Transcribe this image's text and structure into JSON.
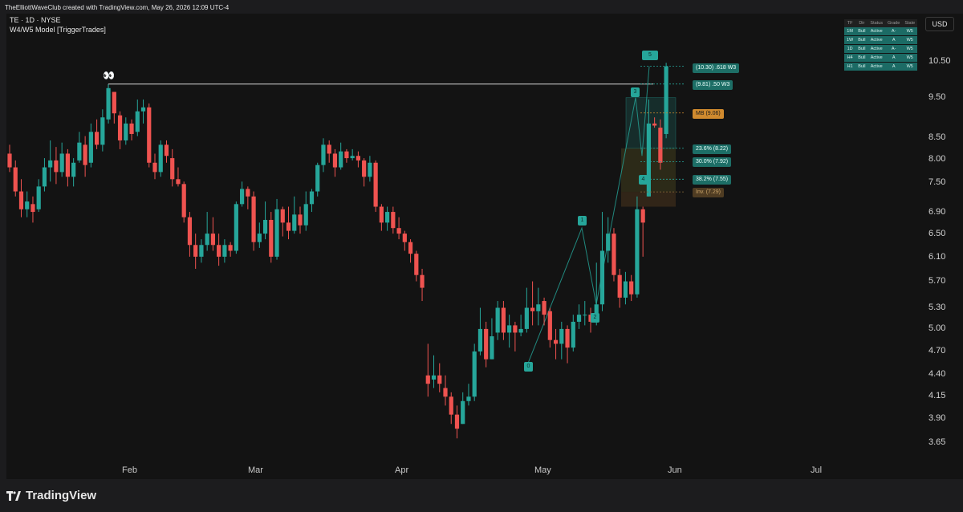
{
  "header": {
    "attribution": "TheElliottWaveClub created with TradingView.com, May 26, 2026 12:09 UTC-4"
  },
  "legend": {
    "symbol_line": "TE · 1D · NYSE",
    "indicator_line": "W4/W5 Model [TriggerTrades]"
  },
  "price_axis": {
    "currency_button": "USD",
    "labels": [
      "10.50",
      "9.50",
      "8.50",
      "8.00",
      "7.50",
      "6.90",
      "6.50",
      "6.10",
      "5.70",
      "5.30",
      "5.00",
      "4.70",
      "4.40",
      "4.15",
      "3.90",
      "3.65"
    ]
  },
  "time_axis": {
    "labels": [
      "Feb",
      "Mar",
      "Apr",
      "May",
      "Jun",
      "Jul"
    ]
  },
  "status_table": {
    "headers": [
      "TF",
      "Dir",
      "Status",
      "Grade",
      "State"
    ],
    "rows": [
      [
        "1M",
        "Bull",
        "Active",
        "A-",
        "W5"
      ],
      [
        "1W",
        "Bull",
        "Active",
        "A",
        "W5"
      ],
      [
        "1D",
        "Bull",
        "Active",
        "A-",
        "W5"
      ],
      [
        "H4",
        "Bull",
        "Active",
        "A",
        "W5"
      ],
      [
        "H1",
        "Bull",
        "Active",
        "A",
        "W5"
      ]
    ]
  },
  "levels": {
    "w3_618": "(10.30) .618 W3",
    "w3_50": "(9.81) .50 W3",
    "mb": "MB (9.06)",
    "fib_236": "23.6% (8.22)",
    "fib_30": "30.0% (7.92)",
    "fib_382": "38.2% (7.55)",
    "inv": "Inv. (7.29)"
  },
  "wave_labels": {
    "w0": "0",
    "w1": "1",
    "w2": "2",
    "w3": "3",
    "w4": "4",
    "w5": "5"
  },
  "annotation": {
    "eyes_icon": "👀"
  },
  "footer": {
    "brand": "TradingView"
  },
  "colors": {
    "up": "#26a69a",
    "down": "#ef5350",
    "background": "#131313",
    "frame": "#1c1c1e"
  },
  "chart_data": {
    "type": "candlestick",
    "symbol": "TE",
    "interval": "1D",
    "exchange": "NYSE",
    "ylim": [
      3.55,
      10.9
    ],
    "candles": [
      [
        8.1,
        7.8,
        8.3,
        7.7
      ],
      [
        7.8,
        7.3,
        7.95,
        7.2
      ],
      [
        7.3,
        6.95,
        7.55,
        6.8
      ],
      [
        6.95,
        7.1,
        7.3,
        6.8
      ],
      [
        7.05,
        6.9,
        7.2,
        6.7
      ],
      [
        6.95,
        7.4,
        7.55,
        6.9
      ],
      [
        7.4,
        7.8,
        8.0,
        7.3
      ],
      [
        7.8,
        7.95,
        8.4,
        7.5
      ],
      [
        7.95,
        7.7,
        8.25,
        7.45
      ],
      [
        7.7,
        8.1,
        8.35,
        7.6
      ],
      [
        8.1,
        7.6,
        8.2,
        7.4
      ],
      [
        7.6,
        7.9,
        8.0,
        7.4
      ],
      [
        7.95,
        8.35,
        8.6,
        7.9
      ],
      [
        8.3,
        7.85,
        8.5,
        7.6
      ],
      [
        7.9,
        8.6,
        8.8,
        7.8
      ],
      [
        8.6,
        8.3,
        8.9,
        8.2
      ],
      [
        8.3,
        8.95,
        9.15,
        8.15
      ],
      [
        8.9,
        9.7,
        9.8,
        8.8
      ],
      [
        9.6,
        9.05,
        9.4,
        8.8
      ],
      [
        9.0,
        8.4,
        9.1,
        8.2
      ],
      [
        8.4,
        8.8,
        8.95,
        8.3
      ],
      [
        8.8,
        8.55,
        8.9,
        8.4
      ],
      [
        8.6,
        9.1,
        9.4,
        8.5
      ],
      [
        9.1,
        9.2,
        9.4,
        8.8
      ],
      [
        9.2,
        7.9,
        9.3,
        7.8
      ],
      [
        7.9,
        7.7,
        8.1,
        7.55
      ],
      [
        7.7,
        8.3,
        8.4,
        7.6
      ],
      [
        8.3,
        8.05,
        8.4,
        7.9
      ],
      [
        8.0,
        7.55,
        8.2,
        7.4
      ],
      [
        7.55,
        7.45,
        7.8,
        7.4
      ],
      [
        7.45,
        6.8,
        7.5,
        6.7
      ],
      [
        6.8,
        6.3,
        6.9,
        6.1
      ],
      [
        6.3,
        6.1,
        6.5,
        5.9
      ],
      [
        6.1,
        6.3,
        6.4,
        6.0
      ],
      [
        6.3,
        6.5,
        6.9,
        6.2
      ],
      [
        6.5,
        6.3,
        6.8,
        6.2
      ],
      [
        6.3,
        6.1,
        6.5,
        5.95
      ],
      [
        6.1,
        6.3,
        6.4,
        6.0
      ],
      [
        6.3,
        6.2,
        6.35,
        6.1
      ],
      [
        6.2,
        7.05,
        7.1,
        6.15
      ],
      [
        7.05,
        7.35,
        7.5,
        7.0
      ],
      [
        7.35,
        7.2,
        7.4,
        6.95
      ],
      [
        7.2,
        6.35,
        7.3,
        6.2
      ],
      [
        6.35,
        6.5,
        6.7,
        6.25
      ],
      [
        6.5,
        6.75,
        7.1,
        6.4
      ],
      [
        6.75,
        6.1,
        6.9,
        6.0
      ],
      [
        6.1,
        6.95,
        7.15,
        6.05
      ],
      [
        6.95,
        6.7,
        7.0,
        6.45
      ],
      [
        6.7,
        6.55,
        7.0,
        6.4
      ],
      [
        6.55,
        6.85,
        7.2,
        6.5
      ],
      [
        6.85,
        6.65,
        7.0,
        6.5
      ],
      [
        6.65,
        7.05,
        7.3,
        6.55
      ],
      [
        7.05,
        7.3,
        7.35,
        6.9
      ],
      [
        7.3,
        7.85,
        7.9,
        7.2
      ],
      [
        7.85,
        8.3,
        8.45,
        7.7
      ],
      [
        8.3,
        8.1,
        8.4,
        7.9
      ],
      [
        8.1,
        7.8,
        8.2,
        7.6
      ],
      [
        7.8,
        8.15,
        8.35,
        7.75
      ],
      [
        8.15,
        8.0,
        8.2,
        7.9
      ],
      [
        8.0,
        8.05,
        8.2,
        7.95
      ],
      [
        8.05,
        7.95,
        8.15,
        7.8
      ],
      [
        7.95,
        7.6,
        8.0,
        7.4
      ],
      [
        7.6,
        7.9,
        8.05,
        7.5
      ],
      [
        7.9,
        7.0,
        7.95,
        6.9
      ],
      [
        7.0,
        6.7,
        7.05,
        6.55
      ],
      [
        6.7,
        6.9,
        7.0,
        6.55
      ],
      [
        6.9,
        6.6,
        7.0,
        6.5
      ],
      [
        6.6,
        6.5,
        6.8,
        6.4
      ],
      [
        6.5,
        6.35,
        6.55,
        6.2
      ],
      [
        6.35,
        6.15,
        6.4,
        6.0
      ],
      [
        6.15,
        5.8,
        6.2,
        5.7
      ],
      [
        5.8,
        5.6,
        5.9,
        5.4
      ],
      [
        4.4,
        4.3,
        4.8,
        4.15
      ],
      [
        4.35,
        4.4,
        4.65,
        4.25
      ],
      [
        4.4,
        4.3,
        4.55,
        4.2
      ],
      [
        4.25,
        4.15,
        4.4,
        4.05
      ],
      [
        4.15,
        3.95,
        4.2,
        3.85
      ],
      [
        3.95,
        3.8,
        4.05,
        3.7
      ],
      [
        3.85,
        4.1,
        4.2,
        3.85
      ],
      [
        4.1,
        4.15,
        4.3,
        4.05
      ],
      [
        4.15,
        4.7,
        4.8,
        4.1
      ],
      [
        4.7,
        5.0,
        5.3,
        4.65
      ],
      [
        5.0,
        4.6,
        5.1,
        4.5
      ],
      [
        4.6,
        4.9,
        5.15,
        4.6
      ],
      [
        4.95,
        5.3,
        5.4,
        4.85
      ],
      [
        5.3,
        4.95,
        5.4,
        4.85
      ],
      [
        4.95,
        5.05,
        5.2,
        4.75
      ],
      [
        5.05,
        4.95,
        5.1,
        4.7
      ],
      [
        4.95,
        5.0,
        5.2,
        4.9
      ],
      [
        5.0,
        5.3,
        5.6,
        4.95
      ],
      [
        5.3,
        5.25,
        5.7,
        5.05
      ],
      [
        5.25,
        5.35,
        5.6,
        5.05
      ],
      [
        5.4,
        5.2,
        5.45,
        5.05
      ],
      [
        5.25,
        4.85,
        5.3,
        4.75
      ],
      [
        4.85,
        4.8,
        5.0,
        4.6
      ],
      [
        4.8,
        5.0,
        5.1,
        4.6
      ],
      [
        5.0,
        4.75,
        5.05,
        4.55
      ],
      [
        4.75,
        5.1,
        5.2,
        4.7
      ],
      [
        5.1,
        5.2,
        5.35,
        5.0
      ],
      [
        5.2,
        5.2,
        5.4,
        5.05
      ],
      [
        5.2,
        5.1,
        5.3,
        4.95
      ],
      [
        5.1,
        5.35,
        6.0,
        5.05
      ],
      [
        5.35,
        6.2,
        6.9,
        5.25
      ],
      [
        6.2,
        6.5,
        6.8,
        6.0
      ],
      [
        6.5,
        5.8,
        6.6,
        5.7
      ],
      [
        5.8,
        5.45,
        5.9,
        5.3
      ],
      [
        5.45,
        5.7,
        5.85,
        5.35
      ],
      [
        5.7,
        5.5,
        5.8,
        5.4
      ],
      [
        5.5,
        6.95,
        7.2,
        5.45
      ],
      [
        6.95,
        6.7,
        7.0,
        6.1
      ],
      [
        7.2,
        8.8,
        9.4,
        7.2
      ],
      [
        8.8,
        8.75,
        8.95,
        8.7
      ],
      [
        8.7,
        7.9,
        8.9,
        7.75
      ],
      [
        8.55,
        10.3,
        10.4,
        8.45
      ]
    ],
    "fib_levels": [
      {
        "label": "(10.30) .618 W3",
        "price": 10.3
      },
      {
        "label": "(9.81) .50 W3",
        "price": 9.81
      },
      {
        "label": "MB (9.06)",
        "price": 9.06
      },
      {
        "label": "23.6% (8.22)",
        "price": 8.22
      },
      {
        "label": "30.0% (7.92)",
        "price": 7.92
      },
      {
        "label": "38.2% (7.55)",
        "price": 7.55
      },
      {
        "label": "Inv. (7.29)",
        "price": 7.29
      }
    ],
    "resistance_line": 9.81,
    "x_ticks": [
      "Feb",
      "Mar",
      "Apr",
      "May",
      "Jun",
      "Jul"
    ],
    "y_ticks": [
      10.5,
      9.5,
      8.5,
      8.0,
      7.5,
      6.9,
      6.5,
      6.1,
      5.7,
      5.3,
      5.0,
      4.7,
      4.4,
      4.15,
      3.9,
      3.65
    ],
    "grid": false
  }
}
